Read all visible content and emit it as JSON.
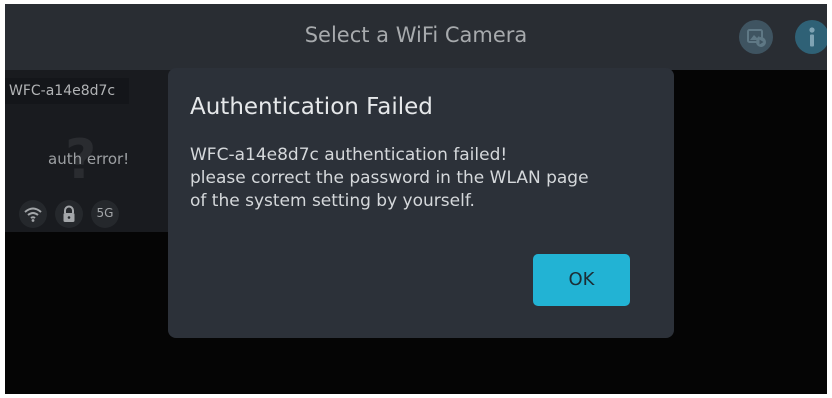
{
  "header": {
    "title": "Select a WiFi Camera"
  },
  "camera_card": {
    "name": "WFC-a14e8d7c",
    "placeholder_glyph": "?",
    "status": "auth error!",
    "band": "5G"
  },
  "dialog": {
    "title": "Authentication Failed",
    "message_lines": [
      "WFC-a14e8d7c authentication failed!",
      "please correct the password in the WLAN page",
      "of the system setting by yourself."
    ],
    "ok_label": "OK"
  },
  "colors": {
    "accent": "#22b3d4",
    "dialog_bg": "#2c3139",
    "topbar_bg": "#292d33"
  },
  "icons": {
    "gallery": "gallery-play-icon",
    "info": "info-icon",
    "wifi": "wifi-icon",
    "lock": "lock-icon"
  }
}
